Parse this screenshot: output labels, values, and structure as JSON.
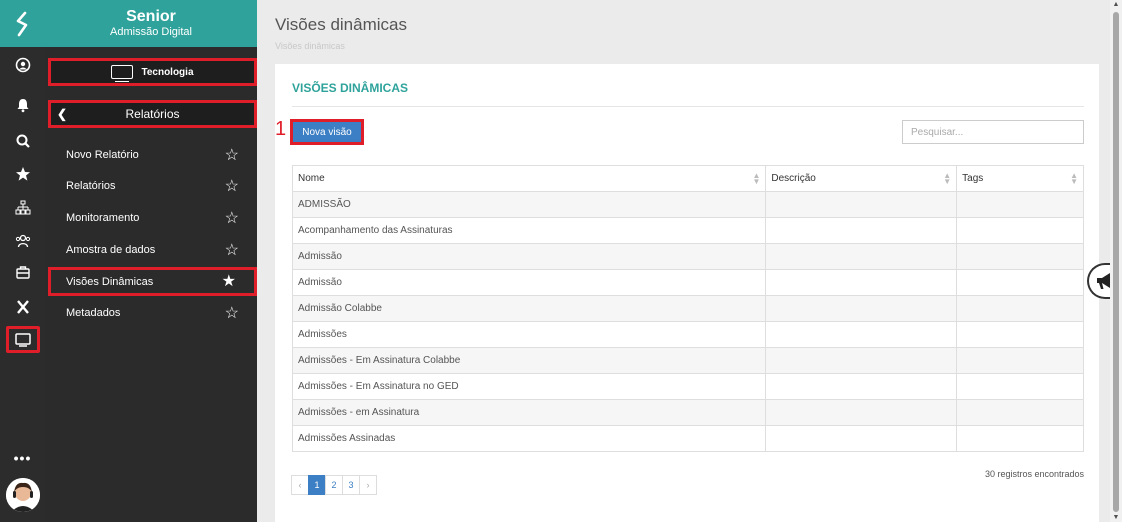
{
  "brand": {
    "name": "Senior",
    "subtitle": "Admissão Digital"
  },
  "rail": {
    "icons": [
      "senior-logo-icon",
      "user-circle-icon",
      "bell-icon",
      "search-icon",
      "star-icon",
      "org-chart-icon",
      "people-icon",
      "briefcase-icon",
      "x-icon",
      "monitor-icon"
    ],
    "more": "•••"
  },
  "menu": {
    "section": "Tecnologia",
    "submenu": "Relatórios",
    "items": [
      {
        "label": "Novo Relatório",
        "favorite": false
      },
      {
        "label": "Relatórios",
        "favorite": false
      },
      {
        "label": "Monitoramento",
        "favorite": false
      },
      {
        "label": "Amostra de dados",
        "favorite": false
      },
      {
        "label": "Visões Dinâmicas",
        "favorite": true
      },
      {
        "label": "Metadados",
        "favorite": false
      }
    ]
  },
  "page": {
    "title": "Visões dinâmicas",
    "breadcrumb": "Visões dinâmicas"
  },
  "card": {
    "title": "VISÕES DINÂMICAS",
    "step_marker": "1",
    "new_button": "Nova visão",
    "search_placeholder": "Pesquisar..."
  },
  "table": {
    "headers": [
      "Nome",
      "Descrição",
      "Tags"
    ],
    "rows": [
      [
        "ADMISSÃO",
        "",
        ""
      ],
      [
        "Acompanhamento das Assinaturas",
        "",
        ""
      ],
      [
        "Admissão",
        "",
        ""
      ],
      [
        "Admissão",
        "",
        ""
      ],
      [
        "Admissão Colabbe",
        "",
        ""
      ],
      [
        "Admissões",
        "",
        ""
      ],
      [
        "Admissões - Em Assinatura Colabbe",
        "",
        ""
      ],
      [
        "Admissões - Em Assinatura no GED",
        "",
        ""
      ],
      [
        "Admissões - em Assinatura",
        "",
        ""
      ],
      [
        "Admissões Assinadas",
        "",
        ""
      ]
    ]
  },
  "pagination": {
    "prev": "‹",
    "pages": [
      "1",
      "2",
      "3"
    ],
    "current": "1",
    "next": "›"
  },
  "records_count": "30 registros encontrados",
  "colors": {
    "teal": "#2fa39b",
    "highlight": "#e01e2a",
    "primary": "#3d7fc4"
  }
}
